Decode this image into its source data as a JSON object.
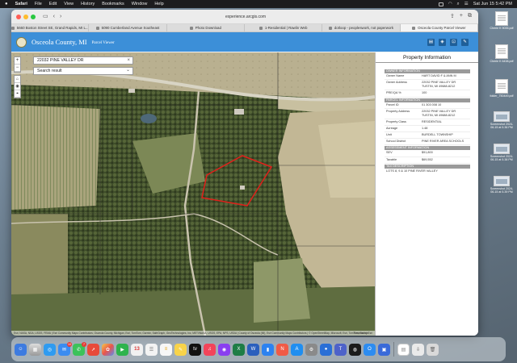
{
  "menubar": {
    "app": "Safari",
    "items": [
      "File",
      "Edit",
      "View",
      "History",
      "Bookmarks",
      "Window",
      "Help"
    ],
    "clock": "Sat Jun 15  5:42 PM"
  },
  "desktop_files": [
    {
      "name": "Cherie K 9035.pdf",
      "kind": "pdf"
    },
    {
      "name": "Cherie K 6438.pdf",
      "kind": "pdf"
    },
    {
      "name": "folder_750449.pdf",
      "kind": "pdf"
    },
    {
      "name": "Screenshot 2024-06-15 at 5.36 PM",
      "kind": "screenshot"
    },
    {
      "name": "Screenshot 2024-06-15 at 5.38 PM",
      "kind": "screenshot"
    },
    {
      "name": "Screenshot 2024-06-15 at 5.39 PM",
      "kind": "screenshot"
    }
  ],
  "browser": {
    "url": "experience.arcgis.com",
    "tabs": [
      {
        "label": "5660 Boston Street SE, Grand Rapids, MI L...",
        "active": false
      },
      {
        "label": "5090 Cumberland Avenue Southeast",
        "active": false
      },
      {
        "label": "Photo Download",
        "active": false
      },
      {
        "label": "1-Residential | Rawlin Web",
        "active": false
      },
      {
        "label": "dotloop - peopleswork, not paperwork",
        "active": false
      },
      {
        "label": "Osceola County Parcel Viewer",
        "active": true
      }
    ]
  },
  "app": {
    "title": "Osceola County, MI",
    "subtitle": "Parcel Viewer"
  },
  "search": {
    "query": "22032 PINE VALLEY DR",
    "clear": "×",
    "result_label": "Search result",
    "chevron": "⌄"
  },
  "map_controls": {
    "zoom_in": "+",
    "zoom_out": "−",
    "home": "⌂",
    "locate": "◉",
    "compass": "⌖"
  },
  "map": {
    "attribution": "Esri, NASA, NGA, USGS, FEMA | Esri Community Maps Contributors, Osceola County, Michigan, Esri, TomTom, Garmin, SafeGraph, GeoTechnologies, Inc, METI/NASA, USGS, EPA, NPS, USDA | County of Osceola (MI), Esri Community Maps Contributors | © OpenStreetMap, Microsoft, Esri, TomTom, Garmin",
    "powered_by": "Powered by Esri",
    "parcel_outline_color": "#e0201a"
  },
  "panel": {
    "title": "Property Information",
    "sections": {
      "owner": {
        "header": "OWNER INFORMATION",
        "owner_name_label": "Owner Name",
        "owner_name": "HART DAVID F & ANN M",
        "owner_address_label": "Owner Address",
        "owner_address_1": "22032 PINE VALLEY DR",
        "owner_address_2": "TUSTIN, MI 49688-8212",
        "pre_label": "PRE/QA %",
        "pre_value": "100"
      },
      "parcel": {
        "header": "PARCEL INFORMATION",
        "parcel_id_label": "Parcel ID",
        "parcel_id": "01 303 008 10",
        "prop_address_label": "Property Address",
        "prop_address_1": "22032 PINE VALLEY DR",
        "prop_address_2": "TUSTIN, MI 49688-8212",
        "class_label": "Property Class",
        "class_value": "RESIDENTIAL",
        "acreage_label": "Acreage",
        "acreage_value": "1.48",
        "unit_label": "Unit",
        "unit_value": "BURDELL TOWNSHIP",
        "school_label": "School District",
        "school_value": "PINE RIVER AREA SCHOOLS"
      },
      "assessment": {
        "header": "ASSESSMENT INFORMATION",
        "sev_label": "SEV",
        "sev_value": "$91,800",
        "taxable_label": "Taxable",
        "taxable_value": "$69,552"
      },
      "tax": {
        "header": "TAX DESCRIPTION",
        "legal": "LOTS 8, 9 & 10 PINE RIVER VALLEY"
      }
    }
  },
  "dock": {
    "calendar_day": "13",
    "mail_badge": "10",
    "messages_badge": "7"
  }
}
